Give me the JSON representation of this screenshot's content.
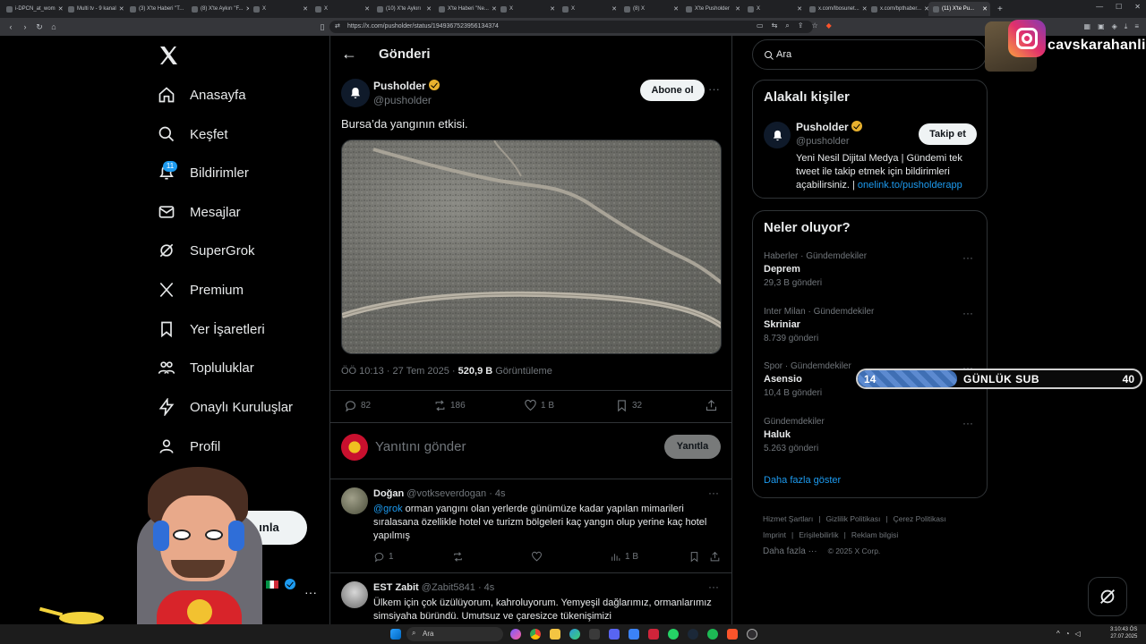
{
  "browser": {
    "tabs": [
      {
        "label": "i-DPCN_at_wom",
        "active": false
      },
      {
        "label": "Multi tv - 9 kanal",
        "active": false
      },
      {
        "label": "(3) X'te Haberi \"T...",
        "active": false
      },
      {
        "label": "(8) X'te Aykırı \"F...",
        "active": false
      },
      {
        "label": "X",
        "active": false
      },
      {
        "label": "X",
        "active": false
      },
      {
        "label": "(10) X'te Aykırı",
        "active": false
      },
      {
        "label": "X'te Haberi \"Ne...",
        "active": false
      },
      {
        "label": "X",
        "active": false
      },
      {
        "label": "X",
        "active": false
      },
      {
        "label": "(8) X",
        "active": false
      },
      {
        "label": "X'te Pusholder",
        "active": false
      },
      {
        "label": "X",
        "active": false
      },
      {
        "label": "x.com/Ibosunet...",
        "active": false
      },
      {
        "label": "x.com/bpthaber...",
        "active": false
      },
      {
        "label": "(11) X'te Pu...",
        "active": true
      }
    ],
    "url": "https://x.com/pusholder/status/1949367523956134374"
  },
  "nav": {
    "items": [
      {
        "label": "Anasayfa",
        "icon": "home-icon"
      },
      {
        "label": "Keşfet",
        "icon": "search-icon"
      },
      {
        "label": "Bildirimler",
        "icon": "bell-icon"
      },
      {
        "label": "Mesajlar",
        "icon": "mail-icon"
      },
      {
        "label": "SuperGrok",
        "icon": "grok-icon"
      },
      {
        "label": "Premium",
        "icon": "x-icon"
      },
      {
        "label": "Yer İşaretleri",
        "icon": "bookmark-icon"
      },
      {
        "label": "Topluluklar",
        "icon": "people-icon"
      },
      {
        "label": "Onaylı Kuruluşlar",
        "icon": "bolt-icon"
      },
      {
        "label": "Profil",
        "icon": "user-icon"
      },
      {
        "label": "a",
        "icon": "more-circle-icon"
      }
    ],
    "notif_count": "11",
    "post_label": "ınla",
    "account_name": "anli"
  },
  "main": {
    "header_title": "Gönderi",
    "post": {
      "author": "Pusholder",
      "handle": "@pusholder",
      "follow_label": "Abone ol",
      "text": "Bursa’da yangının etkisi.",
      "time": "ÖÖ 10:13 · 27 Tem 2025 ·",
      "views": "520,9 B",
      "views_label": "Görüntüleme",
      "stats": {
        "replies": "82",
        "reposts": "186",
        "likes": "1 B",
        "bookmarks": "32"
      }
    },
    "reply_box": {
      "placeholder": "Yanıtını gönder",
      "button": "Yanıtla"
    },
    "replies": [
      {
        "name": "Doğan",
        "handle": "@votkseverdogan",
        "age": "· 4s",
        "mention": "@grok",
        "text": " orman yangını olan yerlerde günümüze kadar yapılan mimarileri sıralasana özellikle hotel ve turizm bölgeleri kaç yangın olup yerine kaç hotel yapılmış",
        "stats": {
          "replies": "1",
          "views": "1 B"
        }
      },
      {
        "name": "EST Zabit",
        "handle": "@Zabit5841",
        "age": "· 4s",
        "text": "Ülkem için çok üzülüyorum, kahroluyorum. Yemyeşil dağlarımız, ormanlarımız simsiyaha büründü. Umutsuz ve çaresizce tükenişimizi"
      }
    ]
  },
  "right": {
    "search_placeholder": "Ara",
    "related": {
      "title": "Alakalı kişiler",
      "name": "Pusholder",
      "handle": "@pusholder",
      "follow_label": "Takip et",
      "bio": "Yeni Nesil Dijital Medya | Gündemi tek tweet ile takip etmek için bildirimleri açabilirsiniz. | ",
      "link": "onelink.to/pusholderapp"
    },
    "trends": {
      "title": "Neler oluyor?",
      "items": [
        {
          "category": "Haberler · Gündemdekiler",
          "name": "Deprem",
          "count": "29,3 B gönderi"
        },
        {
          "category": "Inter Milan · Gündemdekiler",
          "name": "Skriniar",
          "count": "8.739 gönderi"
        },
        {
          "category": "Spor · Gündemdekiler",
          "name": "Asensio",
          "count": "10,4 B gönderi"
        },
        {
          "category": "Gündemdekiler",
          "name": "Haluk",
          "count": "5.263 gönderi"
        }
      ],
      "show_more": "Daha fazla göster"
    },
    "footer": {
      "links": [
        "Hizmet Şartları",
        "Gizlilik Politikası",
        "Çerez Politikası",
        "Imprint",
        "Erişilebilirlik",
        "Reklam bilgisi"
      ],
      "more": "Daha fazla ···",
      "copyright": "© 2025 X Corp."
    }
  },
  "overlay": {
    "instagram_handle": "cavskarahanli",
    "sub_goal": {
      "current": "14",
      "label": "GÜNLÜK SUB",
      "target": "40",
      "progress": 0.35
    }
  },
  "taskbar": {
    "search_placeholder": "Ara",
    "time": "3:10:43 ÖS",
    "date": "27.07.2025"
  },
  "colors": {
    "accent": "#1d9bf0",
    "verified_gold": "#e8b12e",
    "border": "#2f3336"
  }
}
